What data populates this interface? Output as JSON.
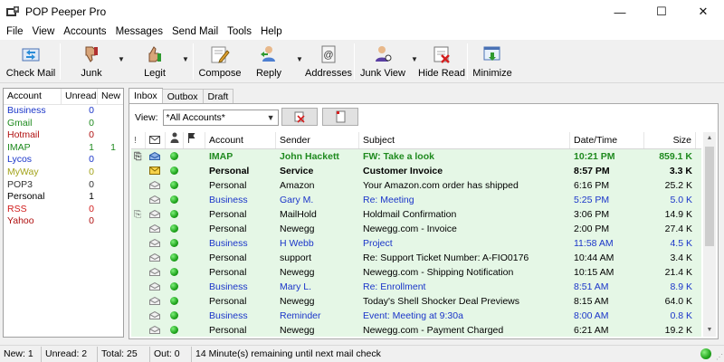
{
  "window": {
    "title": "POP Peeper Pro",
    "minimize": "—",
    "maximize": "☐",
    "close": "✕"
  },
  "menu": [
    "File",
    "View",
    "Accounts",
    "Messages",
    "Send Mail",
    "Tools",
    "Help"
  ],
  "toolbar": {
    "check_mail": "Check Mail",
    "junk": "Junk",
    "legit": "Legit",
    "compose": "Compose",
    "reply": "Reply",
    "addresses": "Addresses",
    "junk_view": "Junk View",
    "hide_read": "Hide Read",
    "minimize": "Minimize"
  },
  "accounts": {
    "headers": [
      "Account",
      "Unread",
      "New"
    ],
    "rows": [
      {
        "name": "Business",
        "unread": "0",
        "new": "",
        "color": "#1a35c9"
      },
      {
        "name": "Gmail",
        "unread": "0",
        "new": "",
        "color": "#1e8a1e"
      },
      {
        "name": "Hotmail",
        "unread": "0",
        "new": "",
        "color": "#b01010"
      },
      {
        "name": "IMAP",
        "unread": "1",
        "new": "1",
        "color": "#1e8a1e"
      },
      {
        "name": "Lycos",
        "unread": "0",
        "new": "",
        "color": "#1a35c9"
      },
      {
        "name": "MyWay",
        "unread": "0",
        "new": "",
        "color": "#a3a31a"
      },
      {
        "name": "POP3",
        "unread": "0",
        "new": "",
        "color": "#333333"
      },
      {
        "name": "Personal",
        "unread": "1",
        "new": "",
        "color": "#000000"
      },
      {
        "name": "RSS",
        "unread": "0",
        "new": "",
        "color": "#d11b1b"
      },
      {
        "name": "Yahoo",
        "unread": "0",
        "new": "",
        "color": "#b01010"
      }
    ]
  },
  "tabs": [
    "Inbox",
    "Outbox",
    "Draft"
  ],
  "view": {
    "label": "View:",
    "selected": "*All Accounts*"
  },
  "grid": {
    "headers": {
      "priority": "!",
      "account": "Account",
      "sender": "Sender",
      "subject": "Subject",
      "date": "Date/Time",
      "size": "Size"
    },
    "rows": [
      {
        "att": true,
        "env": "read-blue",
        "account": "IMAP",
        "sender": "John Hackett",
        "subject": "FW: Take a look",
        "date": "10:21 PM",
        "size": "859.1 K",
        "color": "#1e8a1e",
        "bold": true,
        "green": true
      },
      {
        "att": false,
        "env": "new",
        "account": "Personal",
        "sender": "Service",
        "subject": "Customer Invoice",
        "date": "8:57 PM",
        "size": "3.3 K",
        "color": "#000000",
        "bold": true,
        "green": true
      },
      {
        "att": false,
        "env": "read",
        "account": "Personal",
        "sender": "Amazon",
        "subject": "Your Amazon.com order has shipped",
        "date": "6:16 PM",
        "size": "25.2 K",
        "color": "#000000",
        "bold": false,
        "green": true
      },
      {
        "att": false,
        "env": "read",
        "account": "Business",
        "sender": "Gary M.",
        "subject": "Re: Meeting",
        "date": "5:25 PM",
        "size": "5.0 K",
        "color": "#1a35c9",
        "bold": false,
        "green": true
      },
      {
        "att": true,
        "env": "read",
        "account": "Personal",
        "sender": "MailHold",
        "subject": "Holdmail Confirmation",
        "date": "3:06 PM",
        "size": "14.9 K",
        "color": "#000000",
        "bold": false,
        "green": true
      },
      {
        "att": false,
        "env": "read",
        "account": "Personal",
        "sender": "Newegg",
        "subject": "Newegg.com - Invoice",
        "date": "2:00 PM",
        "size": "27.4 K",
        "color": "#000000",
        "bold": false,
        "green": true
      },
      {
        "att": false,
        "env": "read",
        "account": "Business",
        "sender": "H Webb",
        "subject": "Project",
        "date": "11:58 AM",
        "size": "4.5 K",
        "color": "#1a35c9",
        "bold": false,
        "green": true
      },
      {
        "att": false,
        "env": "read",
        "account": "Personal",
        "sender": "support",
        "subject": "Re: Support Ticket Number: A-FIO0176",
        "date": "10:44 AM",
        "size": "3.4 K",
        "color": "#000000",
        "bold": false,
        "green": true
      },
      {
        "att": false,
        "env": "read",
        "account": "Personal",
        "sender": "Newegg",
        "subject": "Newegg.com - Shipping Notification",
        "date": "10:15 AM",
        "size": "21.4 K",
        "color": "#000000",
        "bold": false,
        "green": true
      },
      {
        "att": false,
        "env": "read",
        "account": "Business",
        "sender": "Mary L.",
        "subject": "Re: Enrollment",
        "date": "8:51 AM",
        "size": "8.9 K",
        "color": "#1a35c9",
        "bold": false,
        "green": true
      },
      {
        "att": false,
        "env": "read",
        "account": "Personal",
        "sender": "Newegg",
        "subject": "Today's Shell Shocker Deal Previews",
        "date": "8:15 AM",
        "size": "64.0 K",
        "color": "#000000",
        "bold": false,
        "green": true
      },
      {
        "att": false,
        "env": "read",
        "account": "Business",
        "sender": "Reminder",
        "subject": "Event: Meeting at 9:30a",
        "date": "8:00 AM",
        "size": "0.8 K",
        "color": "#1a35c9",
        "bold": false,
        "green": true
      },
      {
        "att": false,
        "env": "read",
        "account": "Personal",
        "sender": "Newegg",
        "subject": "Newegg.com - Payment  Charged",
        "date": "6:21 AM",
        "size": "19.2 K",
        "color": "#000000",
        "bold": false,
        "green": true
      }
    ]
  },
  "status": {
    "new": "New: 1",
    "unread": "Unread: 2",
    "total": "Total: 25",
    "out": "Out: 0",
    "message": "14 Minute(s) remaining until next mail check"
  }
}
